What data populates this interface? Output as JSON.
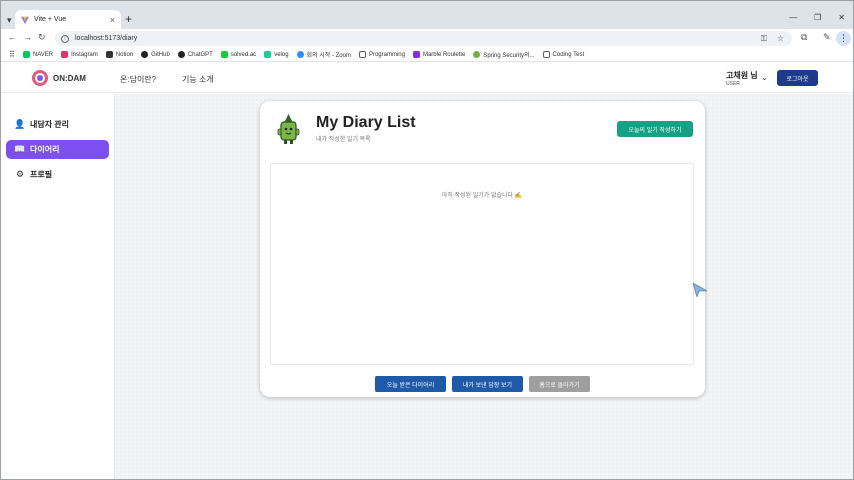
{
  "browser": {
    "tab_title": "Vite + Vue",
    "url": "localhost:5173/diary",
    "bookmarks": [
      {
        "label": "NAVER",
        "color": "#03c75a"
      },
      {
        "label": "Instagram",
        "color": "#e1306c"
      },
      {
        "label": "Notion",
        "color": "#333333"
      },
      {
        "label": "GitHub",
        "color": "#222222"
      },
      {
        "label": "ChatGPT",
        "color": "#222222"
      },
      {
        "label": "solved.ac",
        "color": "#17ce3a"
      },
      {
        "label": "velog",
        "color": "#20c997"
      },
      {
        "label": "회의 시작 - Zoom",
        "color": "#2d8cff"
      },
      {
        "label": "Programming",
        "color": "#5f6368"
      },
      {
        "label": "Marble Roulette",
        "color": "#8a2be2"
      },
      {
        "label": "Spring Security의...",
        "color": "#6db33f"
      },
      {
        "label": "Coding Test",
        "color": "#5f6368"
      }
    ]
  },
  "header": {
    "brand": "ON:DAM",
    "nav": [
      "온:담이란?",
      "기능 소개"
    ],
    "user_name": "고채원 님",
    "user_role": "USER",
    "logout": "로그아웃"
  },
  "sidebar": {
    "items": [
      {
        "label": "내담자 관리",
        "icon": "person-icon",
        "active": false
      },
      {
        "label": "다이어리",
        "icon": "book-icon",
        "active": true
      },
      {
        "label": "프로필",
        "icon": "gear-icon",
        "active": false
      }
    ]
  },
  "main": {
    "title": "My Diary List",
    "subtitle": "내가 작성한 일기 목록",
    "write_button": "오늘의 일기 작성하기",
    "empty_message": "아직 작성된 일기가 없습니다 ✍️",
    "buttons": {
      "received": "오늘 받은 다이어리",
      "sent": "내가 보낸 답장 보기",
      "back": "홈으로 돌아가기"
    }
  },
  "colors": {
    "accent": "#7b4ff0",
    "primary": "#1e5aa8",
    "success": "#16a085",
    "logout": "#1e3a8a"
  }
}
